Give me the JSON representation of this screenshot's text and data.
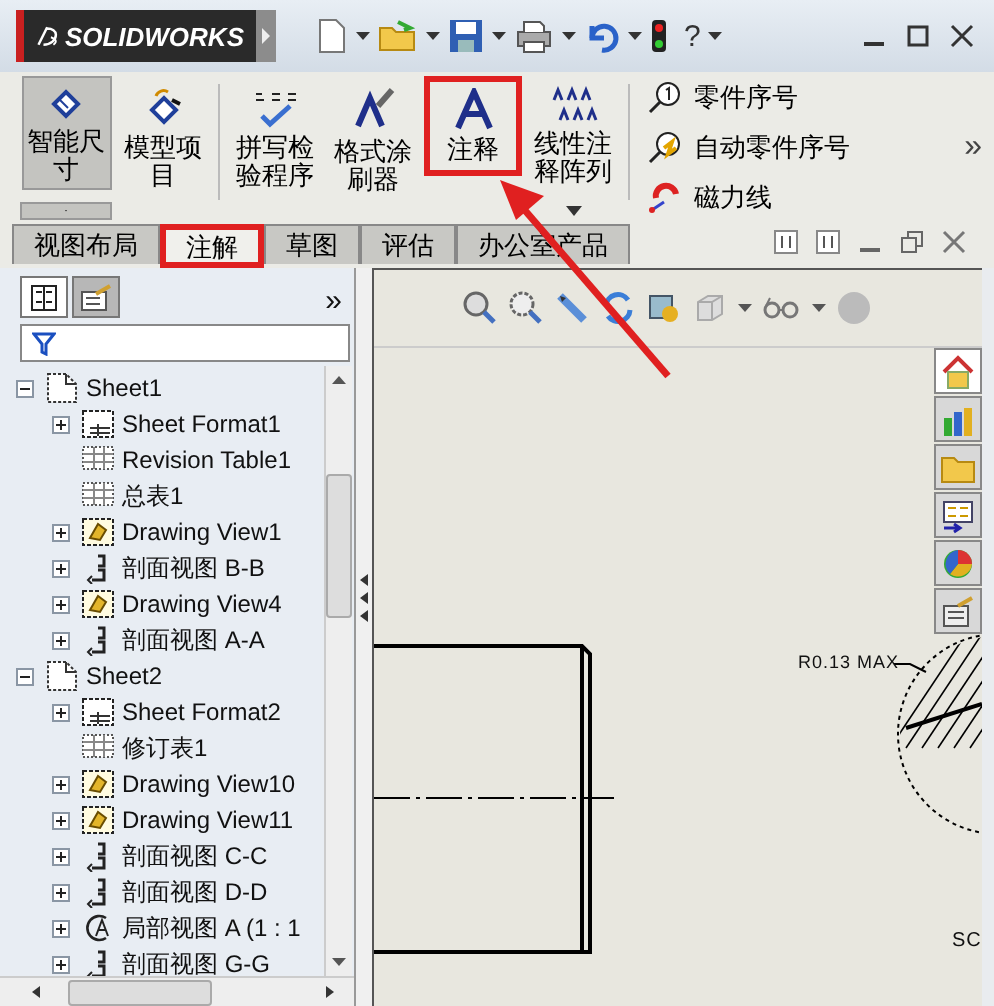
{
  "app": {
    "logo": "SOLIDWORKS",
    "help": "?"
  },
  "ribbon": {
    "groups": [
      {
        "buttons": [
          {
            "label": "智能尺寸",
            "kind": "large",
            "pressed": true,
            "highlighted": false,
            "dropdown": true
          },
          {
            "label": "模型项目",
            "kind": "large",
            "pressed": false,
            "highlighted": false,
            "dropdown": false
          }
        ]
      },
      {
        "buttons": [
          {
            "label": "拼写检验程序",
            "kind": "large",
            "pressed": false,
            "highlighted": false,
            "dropdown": false
          },
          {
            "label": "格式涂刷器",
            "kind": "large",
            "pressed": false,
            "highlighted": false,
            "dropdown": false
          },
          {
            "label": "注释",
            "kind": "large",
            "pressed": false,
            "highlighted": true,
            "dropdown": false
          },
          {
            "label": "线性注释阵列",
            "kind": "large",
            "pressed": false,
            "highlighted": false,
            "dropdown": true
          }
        ]
      },
      {
        "buttons": [
          {
            "label": "零件序号",
            "kind": "small"
          },
          {
            "label": "自动零件序号",
            "kind": "small"
          },
          {
            "label": "磁力线",
            "kind": "small"
          }
        ]
      }
    ],
    "more": "»"
  },
  "tabs": [
    {
      "label": "视图布局",
      "selected": false,
      "highlighted": false
    },
    {
      "label": "注解",
      "selected": true,
      "highlighted": true
    },
    {
      "label": "草图",
      "selected": false,
      "highlighted": false
    },
    {
      "label": "评估",
      "selected": false,
      "highlighted": false
    },
    {
      "label": "办公室产品",
      "selected": false,
      "highlighted": false
    }
  ],
  "feature_panel": {
    "tabs": [
      {
        "selected": true
      },
      {
        "selected": false
      }
    ],
    "more": "»",
    "tree": [
      {
        "label": "Sheet1",
        "kind": "sheet",
        "expanded": true,
        "children": [
          {
            "label": "Sheet Format1",
            "kind": "format",
            "expanded": false
          },
          {
            "label": "Revision Table1",
            "kind": "table"
          },
          {
            "label": "总表1",
            "kind": "table"
          },
          {
            "label": "Drawing View1",
            "kind": "view",
            "expanded": false
          },
          {
            "label": "剖面视图 B-B",
            "kind": "section",
            "expanded": false
          },
          {
            "label": "Drawing View4",
            "kind": "view",
            "expanded": false
          },
          {
            "label": "剖面视图 A-A",
            "kind": "section",
            "expanded": false
          }
        ]
      },
      {
        "label": "Sheet2",
        "kind": "sheet",
        "expanded": true,
        "children": [
          {
            "label": "Sheet Format2",
            "kind": "format",
            "expanded": false
          },
          {
            "label": "修订表1",
            "kind": "table"
          },
          {
            "label": "Drawing View10",
            "kind": "view",
            "expanded": false
          },
          {
            "label": "Drawing View11",
            "kind": "view",
            "expanded": false
          },
          {
            "label": "剖面视图 C-C",
            "kind": "section",
            "expanded": false
          },
          {
            "label": "剖面视图 D-D",
            "kind": "section",
            "expanded": false
          },
          {
            "label": "局部视图 A (1 : 1",
            "kind": "detail",
            "expanded": false
          },
          {
            "label": "剖面视图 G-G",
            "kind": "section",
            "expanded": false
          }
        ]
      }
    ]
  },
  "drawing": {
    "annotations": [
      {
        "text": "R0.13 MAX"
      },
      {
        "text": "SC"
      }
    ]
  }
}
